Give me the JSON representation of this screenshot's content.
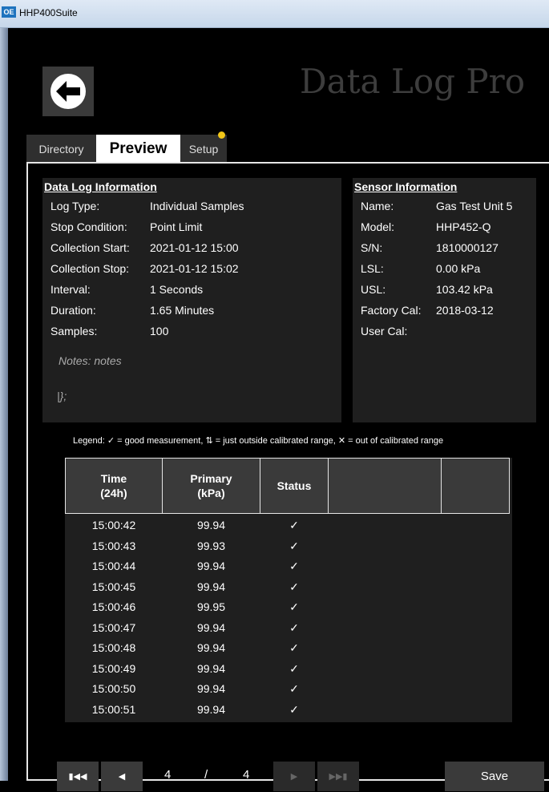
{
  "window": {
    "title": "HHP400Suite",
    "app_icon_text": "OE"
  },
  "header": {
    "app_title": "Data Log Pro"
  },
  "tabs": [
    {
      "label": "Directory"
    },
    {
      "label": "Preview"
    },
    {
      "label": "Setup"
    }
  ],
  "log_info": {
    "title": "Data Log Information",
    "rows": [
      {
        "label": "Log Type:",
        "value": "Individual Samples"
      },
      {
        "label": "Stop Condition:",
        "value": "Point Limit"
      },
      {
        "label": "Collection Start:",
        "value": "2021-01-12  15:00"
      },
      {
        "label": "Collection Stop:",
        "value": "2021-01-12  15:02"
      },
      {
        "label": "Interval:",
        "value": "1 Seconds"
      },
      {
        "label": "Duration:",
        "value": "1.65 Minutes"
      },
      {
        "label": "Samples:",
        "value": "100"
      }
    ],
    "notes": "Notes: notes",
    "notes_extra": "|};"
  },
  "sensor_info": {
    "title": "Sensor Information",
    "rows": [
      {
        "label": "Name:",
        "value": "Gas Test Unit 5"
      },
      {
        "label": "Model:",
        "value": "HHP452-Q"
      },
      {
        "label": "S/N:",
        "value": "1810000127"
      },
      {
        "label": "LSL:",
        "value": "0.00 kPa"
      },
      {
        "label": "USL:",
        "value": "103.42 kPa"
      },
      {
        "label": "Factory Cal:",
        "value": "2018-03-12"
      },
      {
        "label": "User Cal:",
        "value": ""
      }
    ]
  },
  "legend": "Legend:  ✓ = good measurement,  ⇅ = just outside calibrated range,  ✕ = out of calibrated range",
  "table": {
    "headers": {
      "time": "Time\n(24h)",
      "primary": "Primary\n(kPa)",
      "status": "Status",
      "extra1": "",
      "extra2": ""
    },
    "rows": [
      {
        "time": "15:00:42",
        "primary": "99.94",
        "status": "✓"
      },
      {
        "time": "15:00:43",
        "primary": "99.93",
        "status": "✓"
      },
      {
        "time": "15:00:44",
        "primary": "99.94",
        "status": "✓"
      },
      {
        "time": "15:00:45",
        "primary": "99.94",
        "status": "✓"
      },
      {
        "time": "15:00:46",
        "primary": "99.95",
        "status": "✓"
      },
      {
        "time": "15:00:47",
        "primary": "99.94",
        "status": "✓"
      },
      {
        "time": "15:00:48",
        "primary": "99.94",
        "status": "✓"
      },
      {
        "time": "15:00:49",
        "primary": "99.94",
        "status": "✓"
      },
      {
        "time": "15:00:50",
        "primary": "99.94",
        "status": "✓"
      },
      {
        "time": "15:00:51",
        "primary": "99.94",
        "status": "✓"
      }
    ]
  },
  "pager": {
    "current": "4",
    "separator": "/",
    "total": "4"
  },
  "actions": {
    "save_label": "Save"
  },
  "colors": {
    "accent_dot": "#f2c618",
    "panel_bg": "#1f1f1f",
    "button_bg": "#3a3a3a"
  }
}
